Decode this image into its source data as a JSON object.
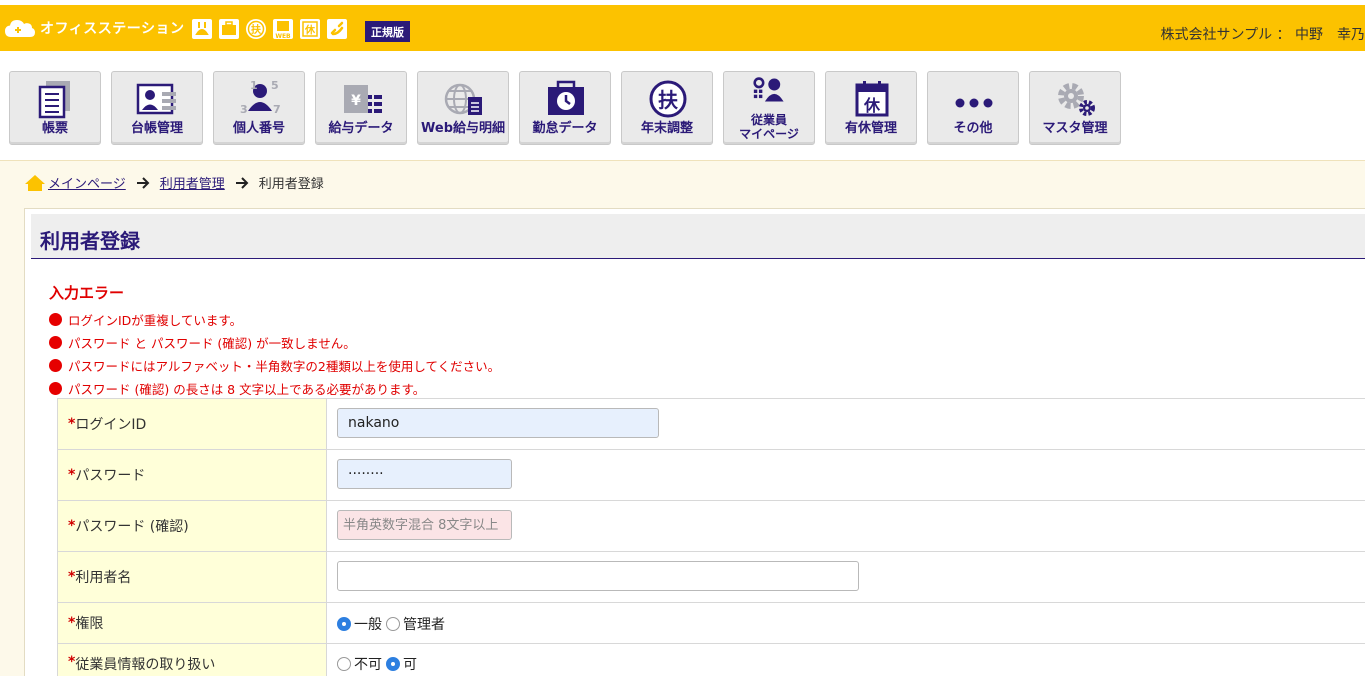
{
  "header": {
    "app_name": "オフィスステーション",
    "edition": "正規版",
    "user": "株式会社サンプル ： 中野　幸乃",
    "icons": [
      "rabbit-icon",
      "briefcase-icon",
      "fu-icon",
      "web-payslip-icon",
      "kyu-icon",
      "phone-icon"
    ]
  },
  "nav": {
    "items": [
      {
        "label": "帳票"
      },
      {
        "label": "台帳管理"
      },
      {
        "label": "個人番号"
      },
      {
        "label": "給与データ"
      },
      {
        "label": "Web給与明細"
      },
      {
        "label": "勤怠データ"
      },
      {
        "label": "年末調整"
      },
      {
        "label": "従業員",
        "label2": "マイページ"
      },
      {
        "label": "有休管理"
      },
      {
        "label": "その他"
      },
      {
        "label": "マスタ管理"
      }
    ]
  },
  "breadcrumb": {
    "home": "メインページ",
    "parent": "利用者管理",
    "current": "利用者登録"
  },
  "page": {
    "title": "利用者登録"
  },
  "errors": {
    "title": "入力エラー",
    "items": [
      "ログインIDが重複しています。",
      "パスワード と パスワード (確認) が一致しません。",
      "パスワードにはアルファベット・半角数字の2種類以上を使用してください。",
      "パスワード (確認) の長さは 8 文字以上である必要があります。"
    ]
  },
  "form": {
    "required_mark": "*",
    "login_id": {
      "label": "ログインID",
      "value": "nakano"
    },
    "password": {
      "label": "パスワード",
      "value": "········"
    },
    "password_confirm": {
      "label": "パスワード (確認)",
      "placeholder": "半角英数字混合 8文字以上"
    },
    "user_name": {
      "label": "利用者名",
      "value": ""
    },
    "authority": {
      "label": "権限",
      "options": [
        "一般",
        "管理者"
      ],
      "selected": "一般"
    },
    "employee_info": {
      "label": "従業員情報の取り扱い",
      "options": [
        "不可",
        "可"
      ],
      "selected": "可"
    }
  },
  "colors": {
    "header_bg": "#fcc200",
    "accent": "#2b1a78",
    "error": "#e00000",
    "label_bg": "#ffffd9",
    "page_bg": "#fdf9ea"
  }
}
